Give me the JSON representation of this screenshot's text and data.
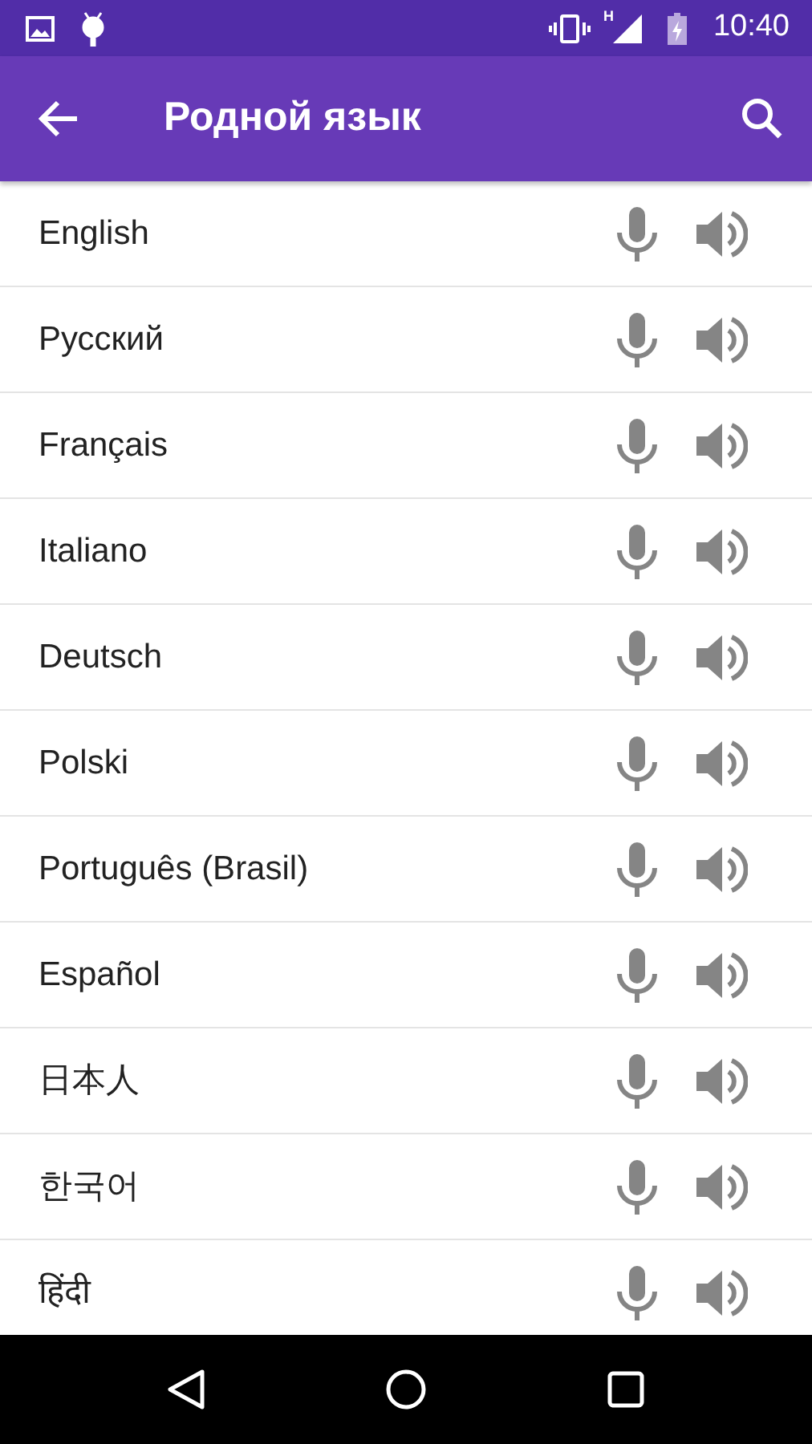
{
  "status_bar": {
    "time": "10:40",
    "network": "H"
  },
  "toolbar": {
    "title": "Родной язык"
  },
  "languages": [
    {
      "name": "English"
    },
    {
      "name": "Русский"
    },
    {
      "name": "Français"
    },
    {
      "name": "Italiano"
    },
    {
      "name": "Deutsch"
    },
    {
      "name": "Polski"
    },
    {
      "name": "Português (Brasil)"
    },
    {
      "name": "Español"
    },
    {
      "name": "日本人"
    },
    {
      "name": "한국어"
    },
    {
      "name": "हिंदी"
    }
  ]
}
